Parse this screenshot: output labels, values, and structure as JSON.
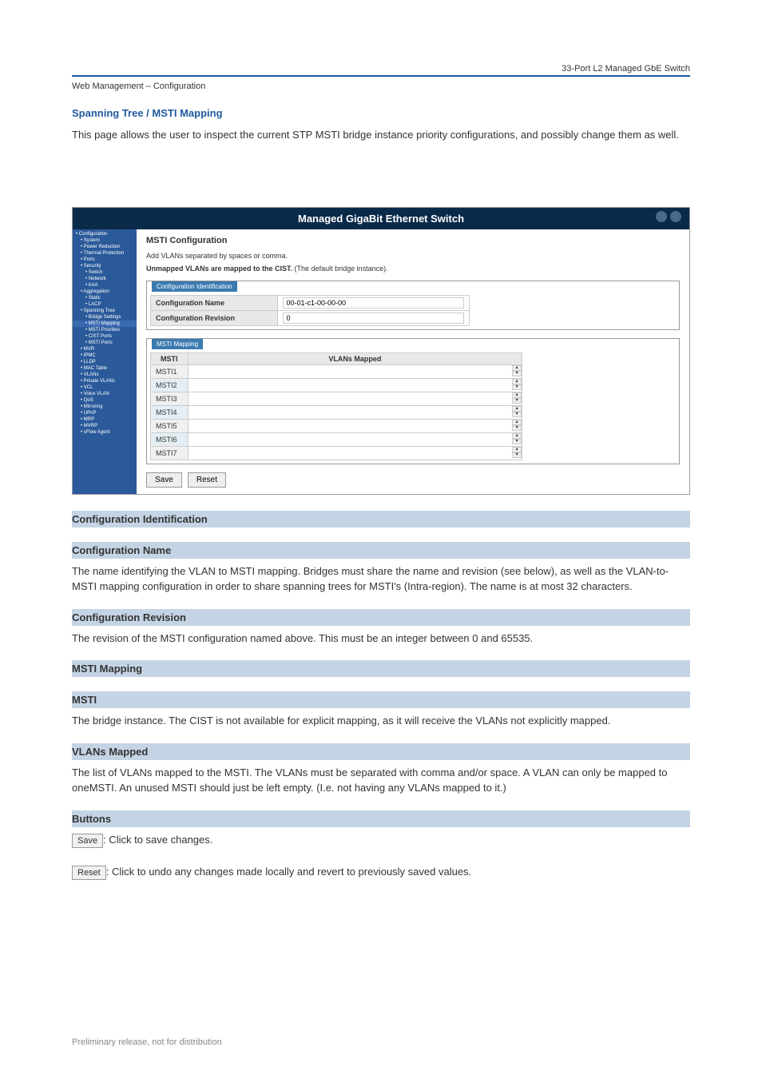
{
  "header": {
    "right": "33-Port L2 Managed GbE Switch",
    "left": "Web Management – Configuration",
    "footer": "Preliminary release, not for distribution"
  },
  "intro": {
    "title": "Spanning Tree / MSTI Mapping",
    "text": "This page allows the user to inspect the current STP MSTI bridge instance priority configurations, and possibly change them as well."
  },
  "app": {
    "title": "Managed GigaBit Ethernet Switch",
    "sidebar": [
      {
        "label": "Configuration",
        "cls": ""
      },
      {
        "label": "System",
        "cls": "sidebar-sub"
      },
      {
        "label": "Power Reduction",
        "cls": "sidebar-sub"
      },
      {
        "label": "Thermal Protection",
        "cls": "sidebar-sub"
      },
      {
        "label": "Ports",
        "cls": "sidebar-sub"
      },
      {
        "label": "Security",
        "cls": "sidebar-sub"
      },
      {
        "label": "Switch",
        "cls": "sidebar-sub2"
      },
      {
        "label": "Network",
        "cls": "sidebar-sub2"
      },
      {
        "label": "AAA",
        "cls": "sidebar-sub2"
      },
      {
        "label": "Aggregation",
        "cls": "sidebar-sub"
      },
      {
        "label": "Static",
        "cls": "sidebar-sub2"
      },
      {
        "label": "LACP",
        "cls": "sidebar-sub2"
      },
      {
        "label": "Spanning Tree",
        "cls": "sidebar-sub"
      },
      {
        "label": "Bridge Settings",
        "cls": "sidebar-sub2"
      },
      {
        "label": "MSTI Mapping",
        "cls": "sidebar-sub2 active"
      },
      {
        "label": "MSTI Priorities",
        "cls": "sidebar-sub2"
      },
      {
        "label": "CIST Ports",
        "cls": "sidebar-sub2"
      },
      {
        "label": "MSTI Ports",
        "cls": "sidebar-sub2"
      },
      {
        "label": "MVR",
        "cls": "sidebar-sub"
      },
      {
        "label": "IPMC",
        "cls": "sidebar-sub"
      },
      {
        "label": "LLDP",
        "cls": "sidebar-sub"
      },
      {
        "label": "MAC Table",
        "cls": "sidebar-sub"
      },
      {
        "label": "VLANs",
        "cls": "sidebar-sub"
      },
      {
        "label": "Private VLANs",
        "cls": "sidebar-sub"
      },
      {
        "label": "VCL",
        "cls": "sidebar-sub"
      },
      {
        "label": "Voice VLAN",
        "cls": "sidebar-sub"
      },
      {
        "label": "QoS",
        "cls": "sidebar-sub"
      },
      {
        "label": "Mirroring",
        "cls": "sidebar-sub"
      },
      {
        "label": "UPnP",
        "cls": "sidebar-sub"
      },
      {
        "label": "MRP",
        "cls": "sidebar-sub"
      },
      {
        "label": "MVRP",
        "cls": "sidebar-sub"
      },
      {
        "label": "sFlow Agent",
        "cls": "sidebar-sub"
      }
    ],
    "main": {
      "title": "MSTI Configuration",
      "subtitle": "Add VLANs separated by spaces or comma.",
      "note1": "Unmapped VLANs are mapped to the CIST.",
      "note2": "(The default bridge instance).",
      "config_legend": "Configuration Identification",
      "config_name_label": "Configuration Name",
      "config_name_value": "00-01-c1-00-00-00",
      "config_rev_label": "Configuration Revision",
      "config_rev_value": "0",
      "mapping_legend": "MSTI Mapping",
      "mapping_col1": "MSTI",
      "mapping_col2": "VLANs Mapped",
      "rows": [
        "MSTI1",
        "MSTI2",
        "MSTI3",
        "MSTI4",
        "MSTI5",
        "MSTI6",
        "MSTI7"
      ],
      "save": "Save",
      "reset": "Reset"
    }
  },
  "doc": {
    "sec1_title": "Configuration Identification",
    "sec2_title": "Configuration Name",
    "sec2_text": "The name identifying the VLAN to MSTI mapping. Bridges must share the name and revision (see below), as well as the VLAN-to-MSTI mapping configuration in order to share spanning trees for MSTI's (Intra-region). The name is at most 32 characters.",
    "sec3_title": "Configuration Revision",
    "sec3_text": "The revision of the MSTI configuration named above. This must be an integer between 0 and 65535.",
    "sec4_title": "MSTI Mapping",
    "sec5_title": "MSTI",
    "sec5_text": "The bridge instance. The CIST is not available for explicit mapping, as it will receive the VLANs not explicitly mapped.",
    "sec6_title": "VLANs Mapped",
    "sec6_text": "The list of VLANs mapped to the MSTI. The VLANs must be separated with comma and/or space. A VLAN can only be mapped to oneMSTI. An unused MSTI should just be left empty. (I.e. not having any VLANs mapped to it.)",
    "sec7_title": "Buttons",
    "btn_save": "Save",
    "btn_save_text": ": Click to save changes.",
    "btn_reset": "Reset",
    "btn_reset_text": ": Click to undo any changes made locally and revert to previously saved values."
  }
}
